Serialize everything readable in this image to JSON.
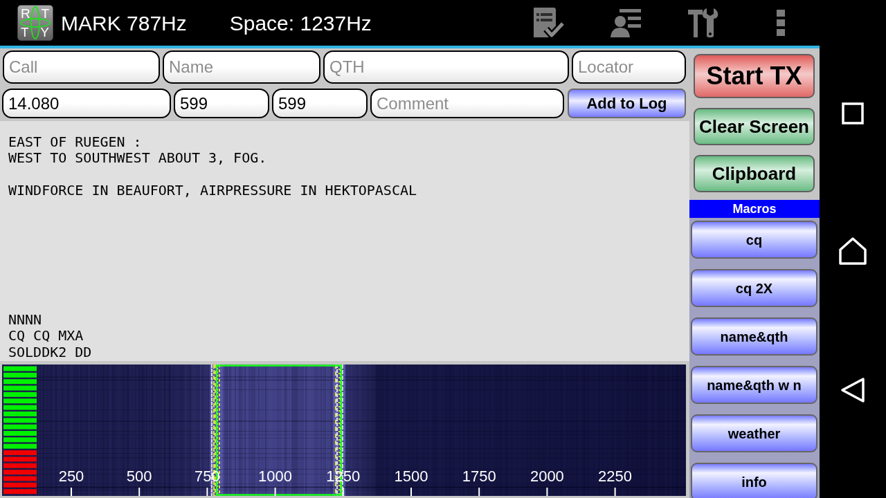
{
  "header": {
    "logo": {
      "letters": [
        "R",
        "T",
        "T",
        "Y"
      ]
    },
    "mark": "MARK 787Hz",
    "space": "Space: 1237Hz"
  },
  "log_form": {
    "rows": [
      [
        {
          "placeholder": "Call"
        },
        {
          "placeholder": "Name"
        },
        {
          "placeholder": "QTH"
        },
        {
          "placeholder": "Locator"
        }
      ],
      [
        {
          "value": "14.080"
        },
        {
          "value": "599"
        },
        {
          "value": "599"
        },
        {
          "placeholder": "Comment"
        }
      ]
    ],
    "add_button": "Add to Log"
  },
  "receive_window": {
    "blocks": [
      [
        "EAST OF RUEGEN :",
        "WEST TO SOUTHWEST ABOUT 3, FOG."
      ],
      [
        "WINDFORCE IN BEAUFORT, AIRPRESSURE IN HEKTOPASCAL"
      ],
      [
        "NNNN",
        "CQ CQ MXA",
        "SOLDDK2 DD"
      ]
    ]
  },
  "waterfall": {
    "scale_labels": [
      "250",
      "500",
      "750",
      "1000",
      "1250",
      "1500",
      "1750",
      "2000",
      "2250"
    ]
  },
  "control_buttons": [
    {
      "label": "Start TX",
      "kind": "transmit"
    },
    {
      "label": "Clear Screen",
      "kind": "utility"
    },
    {
      "label": "Clipboard",
      "kind": "utility"
    }
  ],
  "macros": {
    "title": "Macros",
    "buttons": [
      "cq",
      "cq 2X",
      "name&qth",
      "name&qth w n",
      "weather",
      "info"
    ]
  }
}
